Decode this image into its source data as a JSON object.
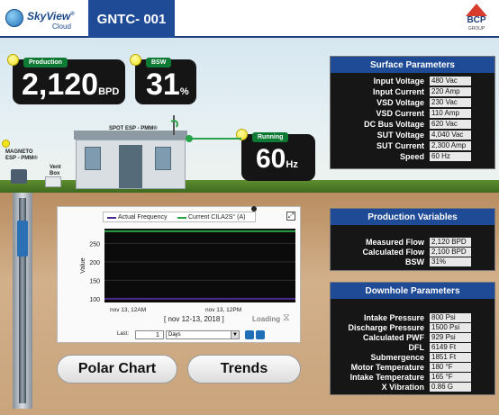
{
  "header": {
    "logo_name": "SkyView",
    "logo_reg": "®",
    "logo_sub": "Cloud",
    "well_title": "GNTC- 001",
    "brand": "BCP",
    "brand_sub": "GROUP"
  },
  "production": {
    "label": "Production",
    "value": "2,120",
    "unit": "BPD"
  },
  "bsw": {
    "label": "BSW",
    "value": "31",
    "unit": "%"
  },
  "running": {
    "label": "Running",
    "value": "60",
    "unit": "Hz"
  },
  "scene": {
    "spot_label": "SPOT ESP - PMM®",
    "magneto_label_line1": "MAGNETO",
    "magneto_label_line2": "ESP - PMM®",
    "vent_label_line1": "Vent",
    "vent_label_line2": "Box"
  },
  "surface": {
    "title": "Surface Parameters",
    "rows": [
      {
        "k": "Input Voltage",
        "v": "480 Vac"
      },
      {
        "k": "Input Current",
        "v": "220 Amp"
      },
      {
        "k": "VSD Voltage",
        "v": "230 Vac"
      },
      {
        "k": "VSD Current",
        "v": "110 Amp"
      },
      {
        "k": "DC Bus Voltage",
        "v": "620 Vac"
      },
      {
        "k": "SUT Voltage",
        "v": "4,040 Vac"
      },
      {
        "k": "SUT Current",
        "v": "2,300 Amp"
      },
      {
        "k": "Speed",
        "v": "60 Hz"
      }
    ]
  },
  "production_vars": {
    "title": "Production Variables",
    "rows": [
      {
        "k": "Measured Flow",
        "v": "2,120 BPD"
      },
      {
        "k": "Calculated Flow",
        "v": "2,100 BPD"
      },
      {
        "k": "BSW",
        "v": "31%"
      }
    ]
  },
  "downhole": {
    "title": "Downhole Parameters",
    "rows": [
      {
        "k": "Intake Pressure",
        "v": "800 Psi"
      },
      {
        "k": "Discharge Pressure",
        "v": "1500 Psi"
      },
      {
        "k": "Calculated PWF",
        "v": "929 Psi"
      },
      {
        "k": "DFL",
        "v": "6149 Ft"
      },
      {
        "k": "Submergence",
        "v": "1851 Ft"
      },
      {
        "k": "Motor Temperature",
        "v": "180 °F"
      },
      {
        "k": "Intake Temperature",
        "v": "165 °F"
      },
      {
        "k": "X Vibration",
        "v": "0.86 G"
      }
    ]
  },
  "chart_window": {
    "date_range": "[ nov 12-13, 2018 ]",
    "loading": "Loading",
    "last_label": "Last:",
    "last_value": "1",
    "unit_select": "Days"
  },
  "chart_data": {
    "type": "line",
    "ylabel": "Value",
    "ylim": [
      90,
      290
    ],
    "yticks": [
      100,
      150,
      200,
      250
    ],
    "xticks": [
      "nov 13, 12AM",
      "nov 13, 12PM"
    ],
    "x_range": [
      0,
      1
    ],
    "series": [
      {
        "name": "Actual Frequency",
        "color": "#4c2a8f",
        "x": [
          0,
          1
        ],
        "y": [
          100,
          100
        ]
      },
      {
        "name": "Current CILA2S° (A)",
        "color": "#2aa344",
        "x": [
          0,
          1
        ],
        "y": [
          283,
          283
        ]
      }
    ]
  },
  "buttons": {
    "polar": "Polar Chart",
    "trends": "Trends"
  }
}
